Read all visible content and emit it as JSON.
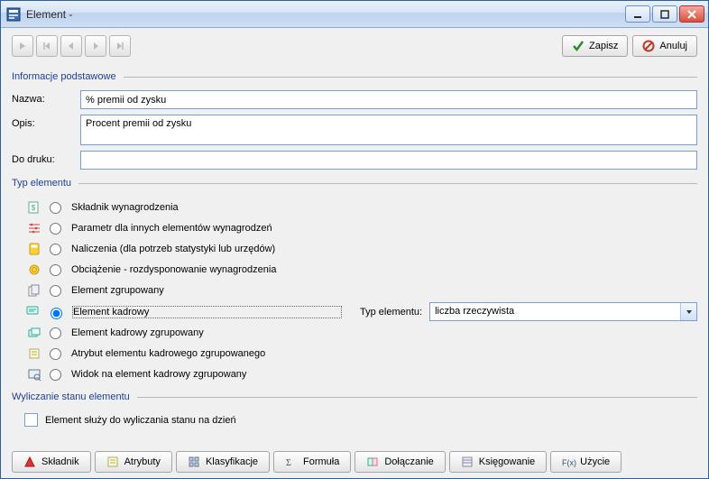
{
  "window": {
    "title": "Element -"
  },
  "toolbar": {
    "save": "Zapisz",
    "cancel": "Anuluj"
  },
  "sections": {
    "basic": "Informacje podstawowe",
    "type": "Typ elementu",
    "calc": "Wyliczanie stanu elementu"
  },
  "fields": {
    "name_label": "Nazwa:",
    "name_value": "% premii od zysku",
    "desc_label": "Opis:",
    "desc_value": "Procent premii od zysku",
    "print_label": "Do druku:",
    "print_value": ""
  },
  "type_options": [
    {
      "id": "skladnik-wynagrodzenia",
      "label": "Składnik wynagrodzenia",
      "icon": "doc-money"
    },
    {
      "id": "parametr-innych",
      "label": "Parametr dla innych elementów wynagrodzeń",
      "icon": "abacus"
    },
    {
      "id": "naliczenia",
      "label": "Naliczenia (dla potrzeb statystyki lub urzędów)",
      "icon": "calc-yellow"
    },
    {
      "id": "obciazenie",
      "label": "Obciążenie - rozdysponowanie wynagrodzenia",
      "icon": "coin"
    },
    {
      "id": "element-zgrupowany",
      "label": "Element zgrupowany",
      "icon": "group-doc"
    },
    {
      "id": "element-kadrowy",
      "label": "Element kadrowy",
      "icon": "card",
      "selected": true
    },
    {
      "id": "element-kadrowy-zgrupowany",
      "label": "Element kadrowy zgrupowany",
      "icon": "group-card"
    },
    {
      "id": "atrybut-kadrowy-zgrupowany",
      "label": "Atrybut elementu kadrowego zgrupowanego",
      "icon": "attrib"
    },
    {
      "id": "widok-kadrowy-zgrupowany",
      "label": "Widok na element kadrowy zgrupowany",
      "icon": "view"
    }
  ],
  "type_field": {
    "label": "Typ elementu:",
    "value": "liczba rzeczywista"
  },
  "calc_checkbox": {
    "label": "Element służy do wyliczania stanu na dzień",
    "checked": false
  },
  "tabs": [
    {
      "id": "skladnik",
      "label": "Składnik",
      "icon": "skladnik"
    },
    {
      "id": "atrybuty",
      "label": "Atrybuty",
      "icon": "atrybuty"
    },
    {
      "id": "klasyfikacje",
      "label": "Klasyfikacje",
      "icon": "klasyfikacje"
    },
    {
      "id": "formula",
      "label": "Formuła",
      "icon": "formula"
    },
    {
      "id": "dolaczanie",
      "label": "Dołączanie",
      "icon": "dolaczanie"
    },
    {
      "id": "ksiegowanie",
      "label": "Księgowanie",
      "icon": "ksiegowanie"
    },
    {
      "id": "uzycie",
      "label": "Użycie",
      "icon": "uzycie"
    }
  ]
}
